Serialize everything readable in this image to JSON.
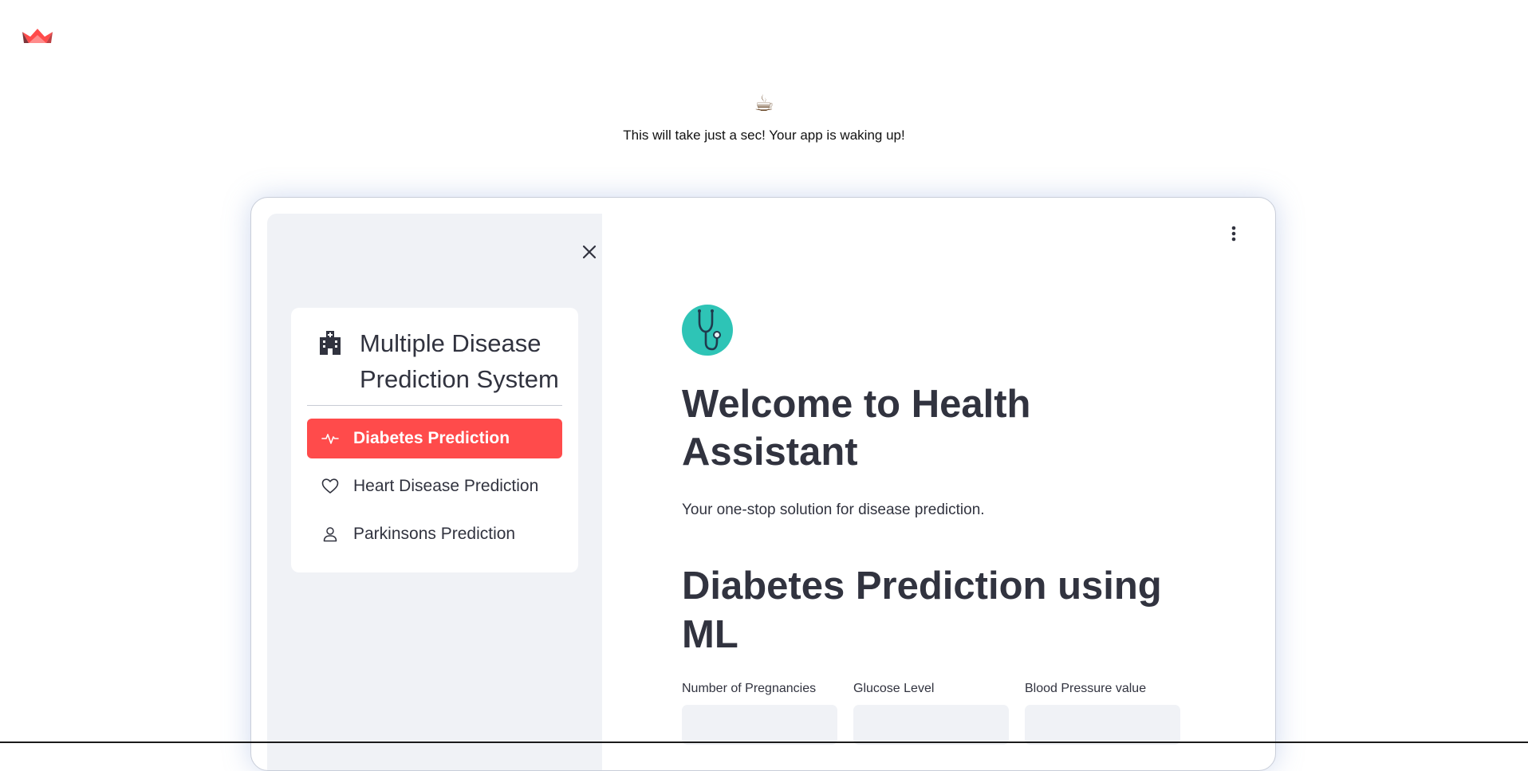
{
  "loading": {
    "icon": "coffee-cup-icon",
    "icon_glyph": "☕",
    "message": "This will take just a sec! Your app is waking up!"
  },
  "colors": {
    "accent": "#ff4b4b",
    "sidebar_bg": "#f0f2f6",
    "avatar_bg": "#2ec4b6",
    "text": "#31333f"
  },
  "sidebar": {
    "title": "Multiple Disease Prediction System",
    "title_icon": "hospital-icon",
    "items": [
      {
        "label": "Diabetes Prediction",
        "icon": "activity-icon",
        "active": true
      },
      {
        "label": "Heart Disease Prediction",
        "icon": "heart-icon",
        "active": false
      },
      {
        "label": "Parkinsons Prediction",
        "icon": "person-icon",
        "active": false
      }
    ]
  },
  "main": {
    "avatar_icon": "stethoscope-icon",
    "welcome_title": "Welcome to Health Assistant",
    "subtitle": "Your one-stop solution for disease prediction.",
    "section_title": "Diabetes Prediction using ML",
    "fields": [
      {
        "label": "Number of Pregnancies",
        "value": ""
      },
      {
        "label": "Glucose Level",
        "value": ""
      },
      {
        "label": "Blood Pressure value",
        "value": ""
      }
    ]
  }
}
